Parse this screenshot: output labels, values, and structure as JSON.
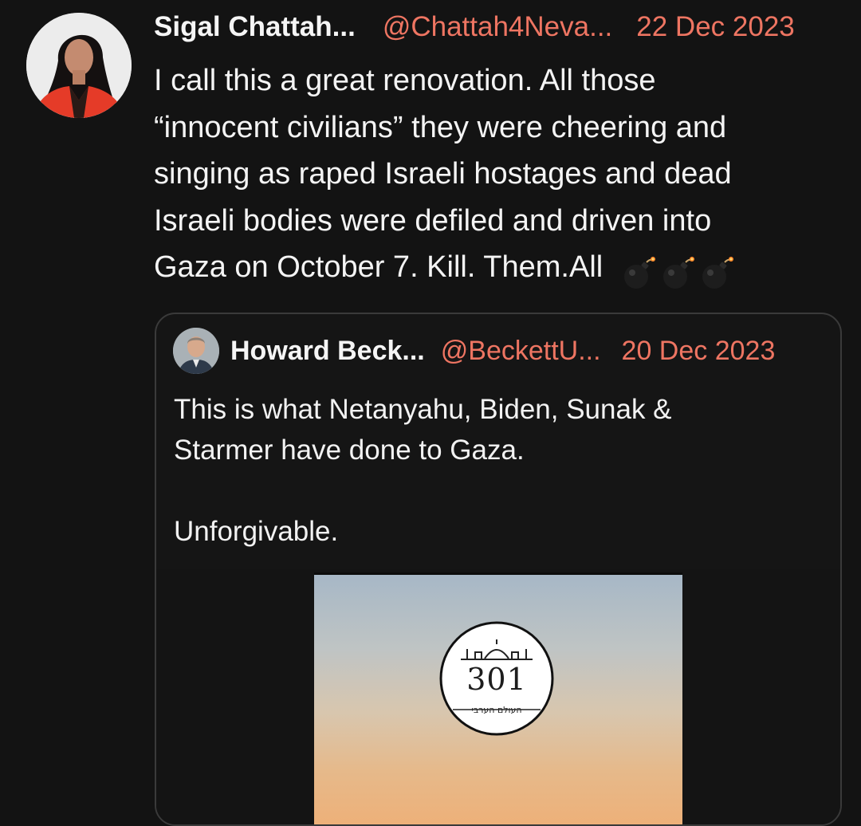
{
  "tweet": {
    "author_name": "Sigal Chattah...",
    "handle": "@Chattah4Neva...",
    "date": "22 Dec 2023",
    "text": "I call this a great renovation. All those\n“innocent civilians” they were cheering and\nsinging as raped Israeli hostages and dead\nIsraeli bodies were defiled and driven into\nGaza on October 7. Kill. Them.All",
    "emoji_icons": [
      "bomb-icon",
      "bomb-icon",
      "bomb-icon"
    ]
  },
  "quote": {
    "author_name": "Howard Beck...",
    "handle": "@BeckettU...",
    "date": "20 Dec 2023",
    "text": "This is what Netanyahu, Biden, Sunak &\nStarmer have done to Gaza.\n\nUnforgivable.",
    "media": {
      "logo_number": "301",
      "logo_caption": "העולם הערבי"
    }
  },
  "colors": {
    "background": "#131313",
    "accent": "#ee7562",
    "text": "#f4f4f4",
    "card_border": "#3a3a3a"
  }
}
